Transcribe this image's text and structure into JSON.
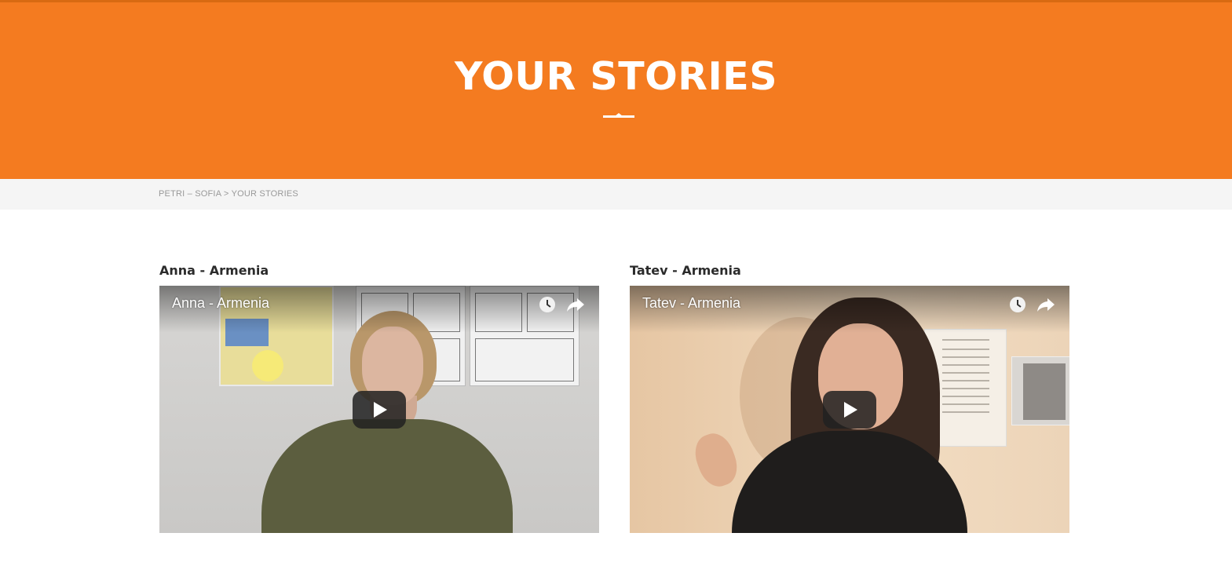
{
  "header": {
    "title": "YOUR STORIES"
  },
  "breadcrumb": {
    "home": "PETRI – SOFIA",
    "separator": ">",
    "current": "YOUR STORIES"
  },
  "stories": [
    {
      "heading": "Anna - Armenia",
      "video_title": "Anna - Armenia",
      "watch_later_icon": "clock-icon",
      "share_icon": "share-arrow-icon",
      "play_icon": "play-icon"
    },
    {
      "heading": "Tatev - Armenia",
      "video_title": "Tatev - Armenia",
      "watch_later_icon": "clock-icon",
      "share_icon": "share-arrow-icon",
      "play_icon": "play-icon"
    }
  ],
  "colors": {
    "accent": "#f47b20",
    "breadcrumb_bg": "#f5f5f5",
    "breadcrumb_text": "#999999",
    "heading_text": "#2b2b2b"
  }
}
